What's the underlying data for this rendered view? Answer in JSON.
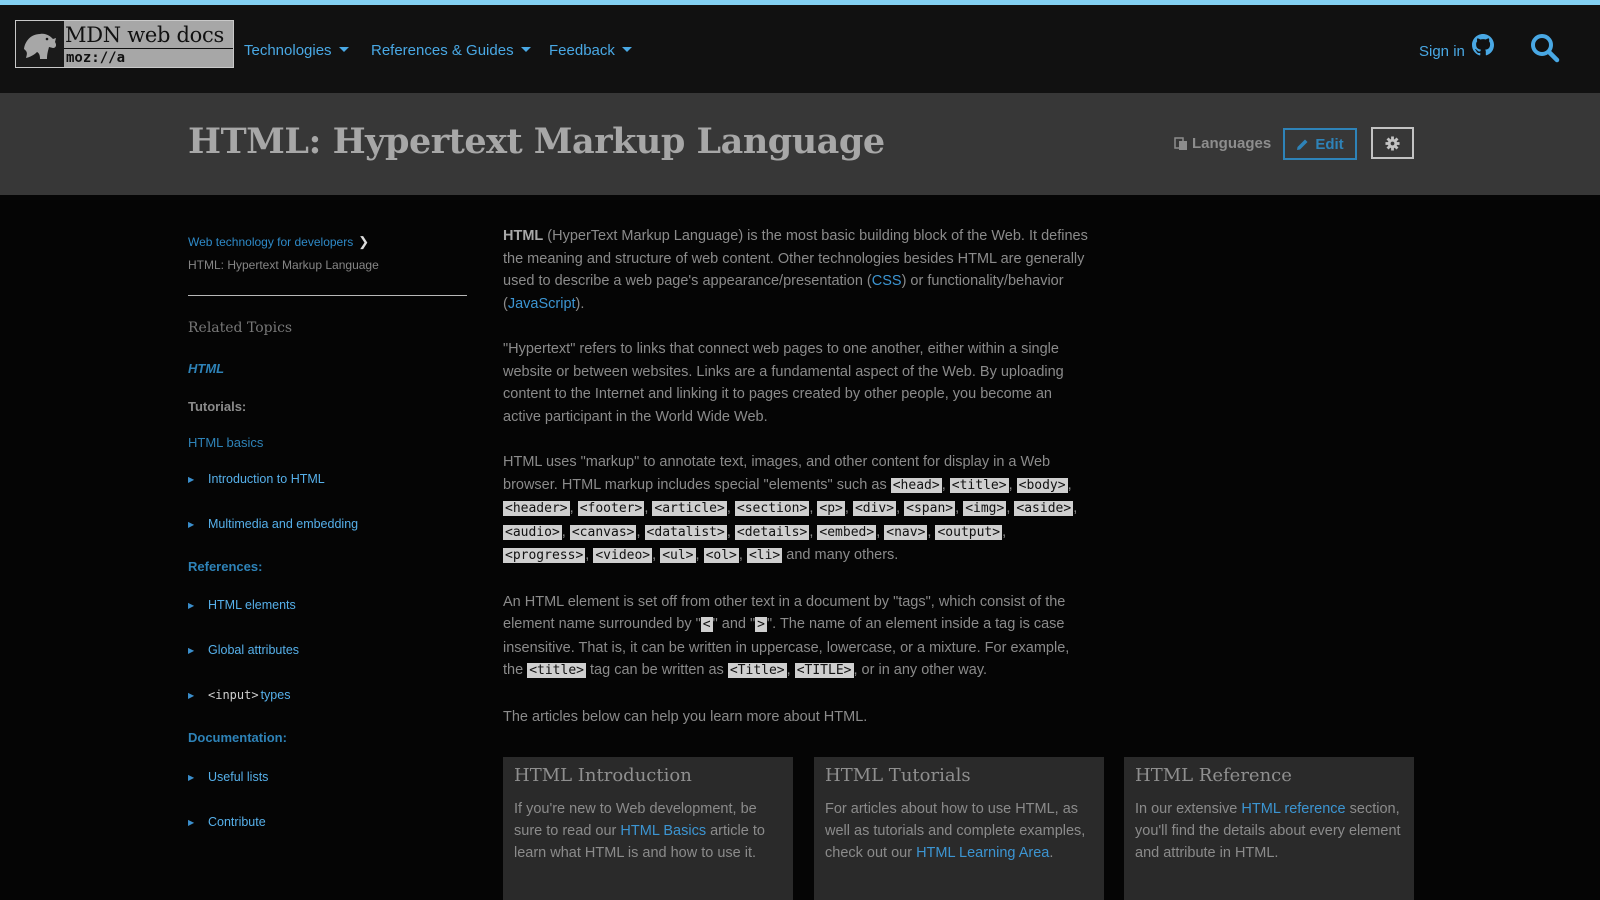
{
  "header": {
    "logo_main": "MDN web docs",
    "logo_sub": "moz://a",
    "nav": [
      {
        "label": "Technologies"
      },
      {
        "label": "References & Guides"
      },
      {
        "label": "Feedback"
      }
    ],
    "signin": "Sign in",
    "accent_color": "#83d0f2"
  },
  "titlebar": {
    "title": "HTML: Hypertext Markup Language",
    "languages": "Languages",
    "edit": "Edit"
  },
  "sidebar": {
    "crumb_parent": "Web technology for developers",
    "crumb_current": "HTML: Hypertext Markup Language",
    "related_title": "Related Topics",
    "html_link": "HTML",
    "tutorials_label": "Tutorials:",
    "html_basics": "HTML basics",
    "tutorial_items": [
      "Introduction to HTML",
      "Multimedia and embedding"
    ],
    "references_label": "References:",
    "reference_items": [
      "HTML elements",
      "Global attributes"
    ],
    "input_code": "<input>",
    "input_suffix": "types",
    "documentation_label": "Documentation:",
    "documentation_items": [
      "Useful lists",
      "Contribute"
    ]
  },
  "content": {
    "p1": {
      "lead": "HTML",
      "t1": " (HyperText Markup Language) is the most basic building block of the Web. It defines the meaning and structure of web content. Other technologies besides HTML are generally used to describe a web page's appearance/presentation (",
      "css": "CSS",
      "t2": ") or functionality/behavior (",
      "js": "JavaScript",
      "t3": ")."
    },
    "p2": "\"Hypertext\" refers to links that connect web pages to one another, either within a single website or between websites. Links are a fundamental aspect of the Web. By uploading content to the Internet and linking it to pages created by other people, you become an active participant in the World Wide Web.",
    "p3": {
      "text": "HTML uses \"markup\" to annotate text, images, and other content for display in a Web browser. HTML markup includes special \"elements\" such as ",
      "tags": [
        "<head>",
        "<title>",
        "<body>",
        "<header>",
        "<footer>",
        "<article>",
        "<section>",
        "<p>",
        "<div>",
        "<span>",
        "<img>",
        "<aside>",
        "<audio>",
        "<canvas>",
        "<datalist>",
        "<details>",
        "<embed>",
        "<nav>",
        "<output>",
        "<progress>",
        "<video>",
        "<ul>",
        "<ol>",
        "<li>"
      ],
      "tail": " and many others."
    },
    "p4": {
      "t1": "An HTML element is set off from other text in a document by \"tags\", which consist of the element name surrounded by \"",
      "lt": "<",
      "t2": "\" and \"",
      "gt": ">",
      "t3": "\".  The name of an element inside a tag is case insensitive. That is, it can be written in uppercase, lowercase, or a mixture. For example, the ",
      "tag1": "<title>",
      "t4": " tag can be written as ",
      "tag2": "<Title>",
      "t5": ", ",
      "tag3": "<TITLE>",
      "t6": ", or in any other way."
    },
    "p5": "The articles below can help you learn more about HTML."
  },
  "cards": [
    {
      "title": "HTML Introduction",
      "t1": "If you're new to Web development, be sure to read our ",
      "link": "HTML Basics",
      "t2": " article to learn what HTML is and how to use it."
    },
    {
      "title": "HTML Tutorials",
      "t1": "For articles about how to use HTML, as well as tutorials and complete examples, check out our ",
      "link": "HTML Learning Area",
      "t2": "."
    },
    {
      "title": "HTML Reference",
      "t1": "In our extensive ",
      "link": "HTML reference",
      "t2": " section, you'll find the details about every element and attribute in HTML."
    }
  ]
}
